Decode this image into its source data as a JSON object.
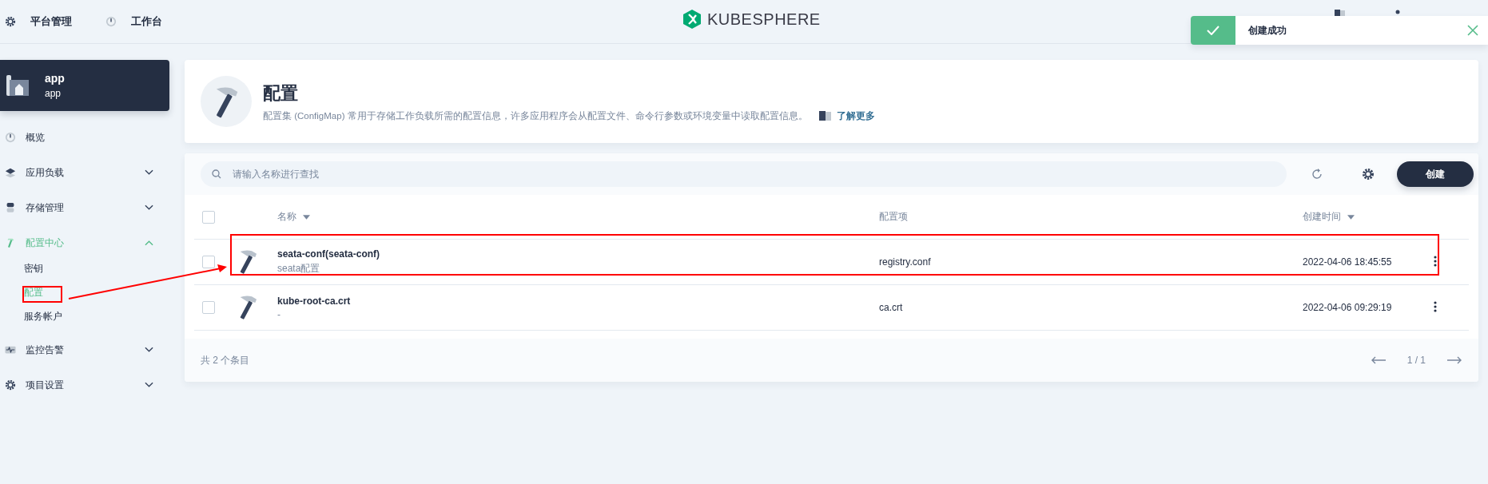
{
  "topbar": {
    "nav": [
      {
        "label": "平台管理",
        "kind": "gear"
      },
      {
        "label": "工作台",
        "kind": "dashboard"
      }
    ],
    "logo": "KUBESPHERE"
  },
  "toast": {
    "message": "创建成功"
  },
  "project": {
    "name": "app",
    "subtitle": "app"
  },
  "sidebar": {
    "items": [
      {
        "label": "概览",
        "kind": "dashboard",
        "selected": false
      },
      {
        "label": "应用负载",
        "kind": "layers",
        "selected": false,
        "expanded": false
      },
      {
        "label": "存储管理",
        "kind": "database",
        "selected": false,
        "expanded": false
      },
      {
        "label": "配置中心",
        "kind": "hammer",
        "selected": true,
        "expanded": true,
        "children": [
          {
            "label": "密钥",
            "selected": false
          },
          {
            "label": "配置",
            "selected": true
          },
          {
            "label": "服务帐户",
            "selected": false
          }
        ]
      },
      {
        "label": "监控告警",
        "kind": "monitor",
        "selected": false,
        "expanded": false
      },
      {
        "label": "项目设置",
        "kind": "gear",
        "selected": false,
        "expanded": false
      }
    ]
  },
  "header": {
    "title": "配置",
    "description": "配置集 (ConfigMap) 常用于存储工作负载所需的配置信息，许多应用程序会从配置文件、命令行参数或环境变量中读取配置信息。",
    "link": "了解更多"
  },
  "toolbar": {
    "search": {
      "placeholder": "请输入名称进行查找"
    },
    "create_button": "创建"
  },
  "table": {
    "all_checked": false,
    "columns": [
      {
        "label": "名称",
        "sortable": true
      },
      {
        "label": "配置项",
        "sortable": false
      },
      {
        "label": "创建时间",
        "sortable": true
      }
    ],
    "rows": [
      {
        "name": "seata-conf(seata-conf)",
        "subtitle": "seata配置",
        "items": "registry.conf",
        "created": "2022-04-06 18:45:55",
        "checked": false
      },
      {
        "name": "kube-root-ca.crt",
        "subtitle": "-",
        "items": "ca.crt",
        "created": "2022-04-06 09:29:19",
        "checked": false
      }
    ],
    "footer": {
      "total": "共 2 个条目",
      "page": "1 / 1"
    }
  }
}
